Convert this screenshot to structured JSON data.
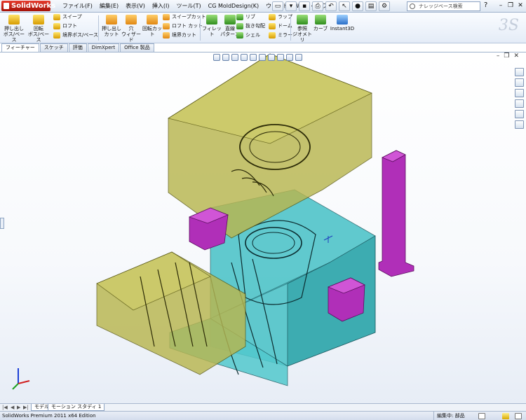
{
  "app": {
    "name": "SolidWorks"
  },
  "menu": [
    "ファイル(F)",
    "編集(E)",
    "表示(V)",
    "挿入(I)",
    "ツール(T)",
    "CG MoldDesign(K)",
    "ウィンドウ(W)",
    "ヘルプ(H)"
  ],
  "search": {
    "placeholder": "ナレッジベース検索"
  },
  "ribbon": {
    "extrude_boss": "押し出し\nボス/ベース",
    "revolve_boss": "回転\nボス/ベース",
    "sweep": "スイープ",
    "loft": "ロフト",
    "boundary_boss": "境界ボス/ベース",
    "extrude_cut": "押し出し\nカット",
    "hole_wizard": "穴\nウィザード",
    "revolve_cut": "回転カット",
    "swept_cut": "スイープカット",
    "lofted_cut": "ロフト カット",
    "boundary_cut": "境界カット",
    "fillet": "フィレット",
    "linear_pattern": "直線\nパターン",
    "rib": "リブ",
    "draft": "抜き勾配",
    "shell": "シェル",
    "wrap": "ラップ",
    "dome": "ドーム",
    "mirror": "ミラー",
    "ref_geometry": "参照\nジオメトリ",
    "curves": "カーブ",
    "instant3d": "Instant3D"
  },
  "tabs": [
    "フィーチャー",
    "スケッチ",
    "評価",
    "DimXpert",
    "Office 製品"
  ],
  "active_tab": 0,
  "bottom_tabs": [
    "モデル",
    "モーション スタディ 1"
  ],
  "status": {
    "edition": "SolidWorks Premium 2011 x64 Edition",
    "editing": "編集中: 部品"
  },
  "colors": {
    "mold_half_olive": "#b8b64f",
    "core_block_cyan": "#46c1c6",
    "slide_magenta": "#b02fb8",
    "ribbon_bg": "#e4ecf7"
  }
}
